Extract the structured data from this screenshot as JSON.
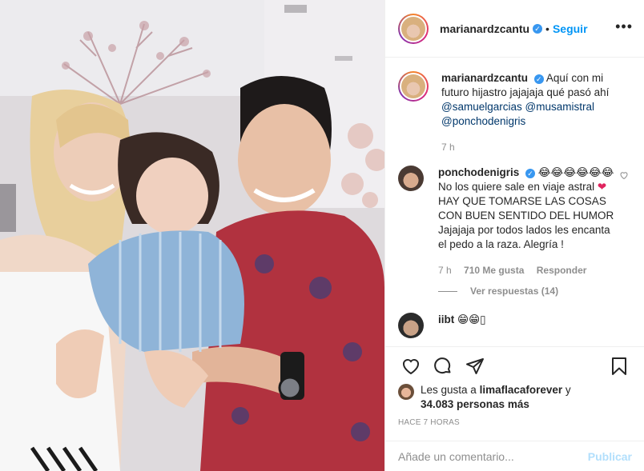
{
  "post": {
    "username": "marianardzcantu",
    "follow_label": "Seguir",
    "more_label": "•••",
    "dot": "•",
    "verified_mark": "✓"
  },
  "caption": {
    "username": "marianardzcantu",
    "text": "Aquí con mi futuro hijastro jajajaja qué pasó ahí",
    "mentions": [
      "@samuelgarcias",
      "@musamistral",
      "@ponchodenigris"
    ],
    "time": "7 h"
  },
  "comments": [
    {
      "username": "ponchodenigris",
      "emoji": "😂😂😂😂😂😂",
      "text_1": "No los quiere sale en viaje astral",
      "heart": "❤",
      "text_2": "HAY QUE TOMARSE LAS COSAS CON BUEN SENTIDO DEL HUMOR Jajajaja por todos lados les encanta el pedo a la raza. Alegría !",
      "time": "7 h",
      "likes": "710 Me gusta",
      "reply": "Responder",
      "view_replies": "Ver respuestas (14)"
    },
    {
      "username": "iibt",
      "emoji": "😁😁▯"
    }
  ],
  "likes": {
    "prefix": "Les gusta a",
    "user": "limaflacaforever",
    "and": "y",
    "count": "34.083 personas más"
  },
  "timestamp": "HACE 7 HORAS",
  "add_comment": {
    "placeholder": "Añade un comentario...",
    "publish": "Publicar"
  },
  "colors": {
    "link": "#0095f6",
    "mention": "#00376b",
    "muted": "#8e8e8e",
    "publish_disabled": "#b2dffc",
    "heart": "#e0245e"
  }
}
